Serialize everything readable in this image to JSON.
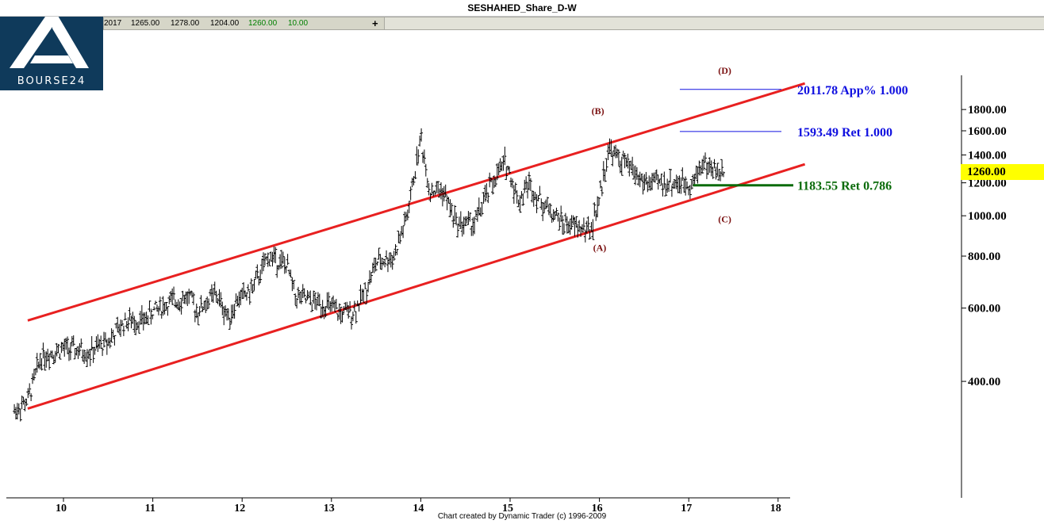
{
  "title": "SESHAHED_Share_D-W",
  "logo": {
    "text": "BOURSE24"
  },
  "ohlc_bar": {
    "values": [
      "2017",
      "1265.00",
      "1278.00",
      "1204.00",
      "1260.00",
      "10.00"
    ],
    "plus": "+"
  },
  "footer": "Chart created by Dynamic Trader  (c) 1996-2009",
  "current_price": "1260.00",
  "chart_data": {
    "type": "bar",
    "scale": "log",
    "x_tick_labels": [
      "10",
      "11",
      "12",
      "13",
      "14",
      "15",
      "16",
      "17",
      "18"
    ],
    "xlim": [
      9.4,
      18.3
    ],
    "y_tick_labels": [
      "1800.00",
      "1600.00",
      "1400.00",
      "1200.00",
      "1000.00",
      "800.00",
      "600.00",
      "400.00"
    ],
    "y_ticks": [
      1800,
      1600,
      1400,
      1200,
      1000,
      800,
      600,
      400
    ],
    "ylim": [
      330,
      2200
    ],
    "series_path": [
      [
        9.45,
        340
      ],
      [
        9.6,
        360
      ],
      [
        9.75,
        460
      ],
      [
        10.0,
        480
      ],
      [
        10.3,
        470
      ],
      [
        10.5,
        500
      ],
      [
        10.7,
        560
      ],
      [
        10.9,
        560
      ],
      [
        11.0,
        590
      ],
      [
        11.2,
        620
      ],
      [
        11.4,
        640
      ],
      [
        11.5,
        590
      ],
      [
        11.7,
        650
      ],
      [
        11.85,
        570
      ],
      [
        11.95,
        630
      ],
      [
        12.1,
        660
      ],
      [
        12.3,
        800
      ],
      [
        12.5,
        760
      ],
      [
        12.6,
        640
      ],
      [
        12.8,
        620
      ],
      [
        12.95,
        610
      ],
      [
        13.1,
        580
      ],
      [
        13.25,
        590
      ],
      [
        13.35,
        640
      ],
      [
        13.5,
        770
      ],
      [
        13.7,
        800
      ],
      [
        13.85,
        1000
      ],
      [
        14.0,
        1550
      ],
      [
        14.1,
        1150
      ],
      [
        14.25,
        1150
      ],
      [
        14.4,
        960
      ],
      [
        14.6,
        960
      ],
      [
        14.8,
        1200
      ],
      [
        14.95,
        1350
      ],
      [
        15.1,
        1080
      ],
      [
        15.2,
        1200
      ],
      [
        15.35,
        1080
      ],
      [
        15.6,
        960
      ],
      [
        15.75,
        940
      ],
      [
        15.9,
        920
      ],
      [
        16.0,
        1100
      ],
      [
        16.1,
        1450
      ],
      [
        16.2,
        1380
      ],
      [
        16.35,
        1300
      ],
      [
        16.5,
        1200
      ],
      [
        16.7,
        1200
      ],
      [
        16.9,
        1200
      ],
      [
        17.05,
        1200
      ],
      [
        17.15,
        1350
      ],
      [
        17.3,
        1280
      ],
      [
        17.4,
        1260
      ]
    ],
    "channel_lines": [
      {
        "name": "upper",
        "from": [
          9.6,
          560
        ],
        "to": [
          18.3,
          2080
        ]
      },
      {
        "name": "lower",
        "from": [
          9.6,
          344
        ],
        "to": [
          18.3,
          1330
        ]
      }
    ],
    "wave_labels": [
      {
        "text": "(A)",
        "x": 16.0,
        "y": 890
      },
      {
        "text": "(B)",
        "x": 16.0,
        "y": 1680
      },
      {
        "text": "(C)",
        "x": 17.4,
        "y": 1100
      },
      {
        "text": "(D)",
        "x": 17.4,
        "y": 2080
      }
    ],
    "levels": [
      {
        "label": "2011.78 App% 1.000",
        "value": 2011.78,
        "x_start": 16.9,
        "color": "#1010e0"
      },
      {
        "label": "1593.49 Ret 1.000",
        "value": 1593.49,
        "x_start": 16.9,
        "color": "#1010e0"
      },
      {
        "label": "1183.55 Ret 0.786",
        "value": 1183.55,
        "x_start": 17.05,
        "color": "#0a6b0a"
      }
    ],
    "colors": {
      "bars": "#000000",
      "channel": "#e82020",
      "wave_label": "#7a1010"
    }
  }
}
